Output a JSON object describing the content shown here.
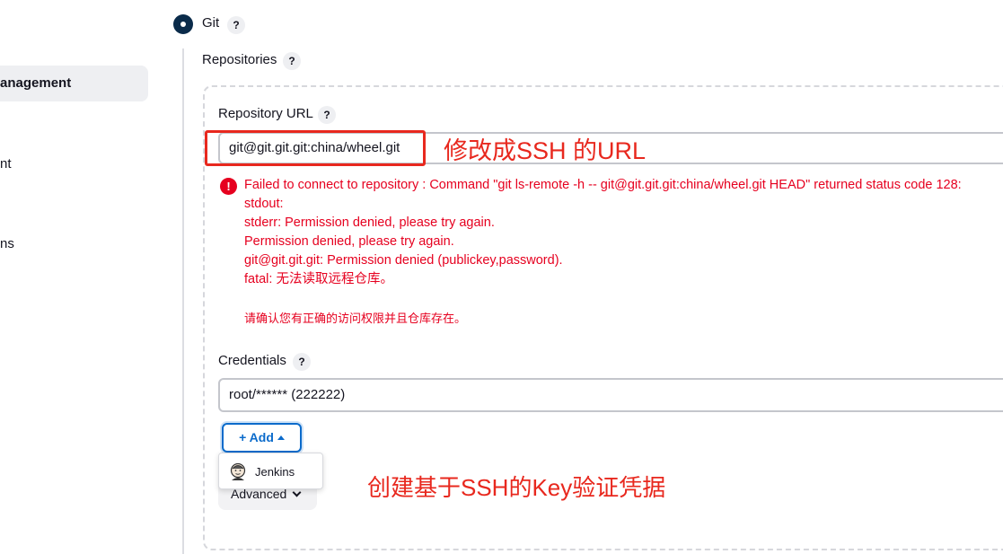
{
  "sidebar": {
    "active_item": "anagement",
    "item_2": "nt",
    "item_3": "ns"
  },
  "git": {
    "label": "Git",
    "help": "?"
  },
  "repositories": {
    "label": "Repositories",
    "help": "?"
  },
  "repository_url": {
    "label": "Repository URL",
    "help": "?",
    "value": "git@git.git.git:china/wheel.git",
    "annotation": "修改成SSH 的URL"
  },
  "error": {
    "icon": "!",
    "lines": [
      "Failed to connect to repository : Command \"git ls-remote -h -- git@git.git.git:china/wheel.git HEAD\" returned status code 128:",
      "stdout:",
      "stderr: Permission denied, please try again.",
      "Permission denied, please try again.",
      "git@git.git.git: Permission denied (publickey,password).",
      "fatal: 无法读取远程仓库。"
    ],
    "extra": "请确认您有正确的访问权限并且仓库存在。"
  },
  "credentials": {
    "label": "Credentials",
    "help": "?",
    "value": "root/****** (222222)",
    "add_label": "+ Add",
    "dropdown_item": "Jenkins",
    "annotation": "创建基于SSH的Key验证凭据"
  },
  "advanced": {
    "label": "Advanced"
  },
  "colors": {
    "annotation_red": "#e8281e",
    "error_red": "#e6001f",
    "primary_blue": "#0b6bcb"
  }
}
